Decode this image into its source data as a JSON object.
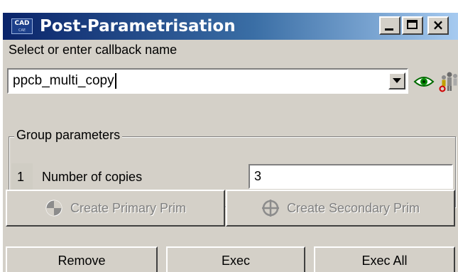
{
  "window": {
    "title": "Post-Parametrisation",
    "icon_text": "CAD",
    "icon_subtext": "CAE"
  },
  "title_buttons": {
    "minimize": "minimize",
    "maximize": "maximize",
    "close": "×"
  },
  "callback": {
    "label": "Select or enter callback name",
    "value": "ppcb_multi_copy",
    "icons": [
      "eye-icon",
      "people-icon"
    ]
  },
  "group": {
    "title": "Group parameters",
    "rows": [
      {
        "index": "1",
        "label": "Number of copies",
        "value": "3"
      }
    ]
  },
  "buttons": {
    "create_primary": "Create Primary Prim",
    "create_secondary": "Create Secondary Prim",
    "remove": "Remove",
    "exec": "Exec",
    "exec_all": "Exec All"
  },
  "colors": {
    "title_bar_start": "#0a246a",
    "title_bar_end": "#a6caf0",
    "window_bg": "#d4d0c8",
    "disabled_text": "#808080"
  }
}
